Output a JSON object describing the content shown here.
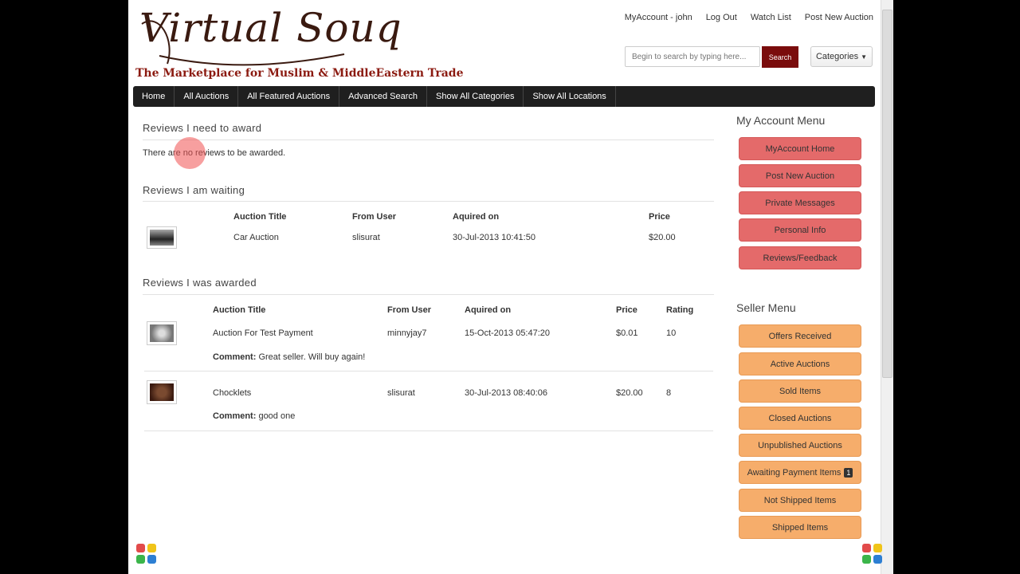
{
  "logo": {
    "text": "Virtual Souq",
    "tagline": "The Marketplace for Muslim & MiddleEastern Trade"
  },
  "top_links": [
    "MyAccount - john",
    "Log Out",
    "Watch List",
    "Post New Auction"
  ],
  "search": {
    "placeholder": "Begin to search by typing here...",
    "button": "Search"
  },
  "categories_button": "Categories",
  "nav": [
    "Home",
    "All Auctions",
    "All Featured Auctions",
    "Advanced Search",
    "Show All Categories",
    "Show All Locations"
  ],
  "reviews_to_award": {
    "title": "Reviews I need to award",
    "empty_text": "There are no reviews to be awarded."
  },
  "reviews_waiting": {
    "title": "Reviews I am waiting",
    "headers": [
      "Auction Title",
      "From User",
      "Aquired on",
      "Price"
    ],
    "rows": [
      {
        "title": "Car Auction",
        "user": "slisurat",
        "date": "30-Jul-2013 10:41:50",
        "price": "$20.00"
      }
    ]
  },
  "reviews_awarded": {
    "title": "Reviews I was awarded",
    "headers": [
      "Auction Title",
      "From User",
      "Aquired on",
      "Price",
      "Rating"
    ],
    "comment_label": "Comment:",
    "rows": [
      {
        "title": "Auction For Test Payment",
        "user": "minnyjay7",
        "date": "15-Oct-2013 05:47:20",
        "price": "$0.01",
        "rating": "10",
        "comment": " Great seller. Will buy again!"
      },
      {
        "title": "Chocklets",
        "user": "slisurat",
        "date": "30-Jul-2013 08:40:06",
        "price": "$20.00",
        "rating": "8",
        "comment": " good one"
      }
    ]
  },
  "account_menu": {
    "title": "My Account Menu",
    "items": [
      "MyAccount Home",
      "Post New Auction",
      "Private Messages",
      "Personal Info",
      "Reviews/Feedback"
    ]
  },
  "seller_menu": {
    "title": "Seller Menu",
    "items": [
      "Offers Received",
      "Active Auctions",
      "Sold Items",
      "Closed Auctions",
      "Unpublished Auctions",
      "Awaiting Payment Items",
      "Not Shipped Items",
      "Shipped Items"
    ],
    "badge": "1"
  },
  "colors": {
    "nav_bg": "#1f1f1f",
    "account_btn": "#e46a6a",
    "seller_btn": "#f6ad6b",
    "search_btn": "#7a0c0c"
  }
}
